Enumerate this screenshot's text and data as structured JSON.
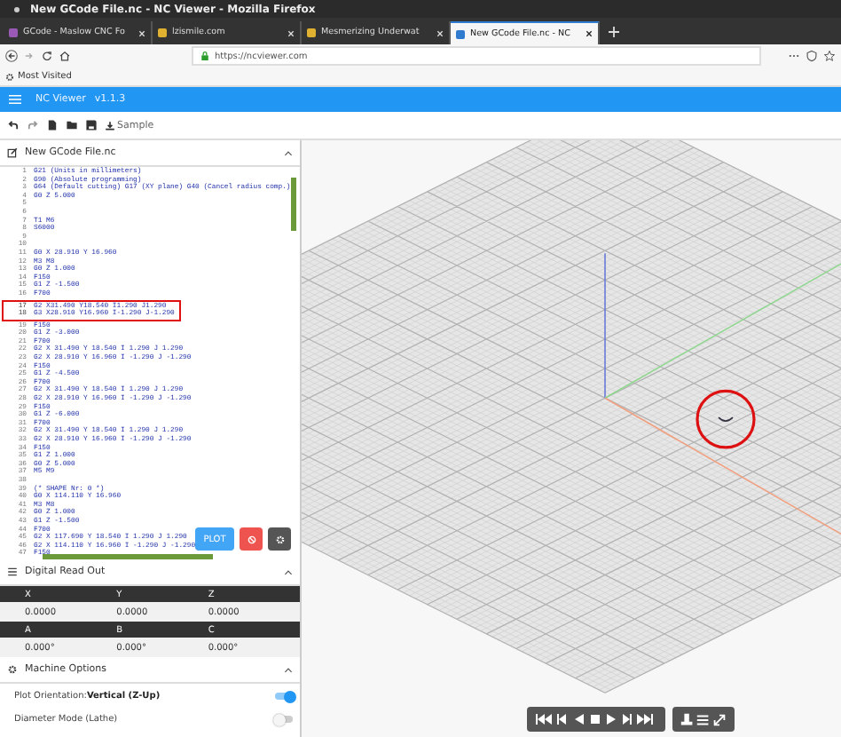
{
  "window": {
    "title": "New GCode File.nc - NC Viewer - Mozilla Firefox"
  },
  "browser_tabs": [
    {
      "label": "GCode - Maslow CNC Fo",
      "color": "#9b59b6",
      "selected": false
    },
    {
      "label": "lzismile.com",
      "color": "#e0b030",
      "selected": false
    },
    {
      "label": "Mesmerizing Underwat",
      "color": "#e0b030",
      "selected": false
    },
    {
      "label": "New GCode File.nc - NC",
      "color": "#2e7bcf",
      "selected": true
    }
  ],
  "address_bar": {
    "url": "https://ncviewer.com"
  },
  "bookmarks": [
    "Most Visited"
  ],
  "app": {
    "title": "NC Viewer",
    "version": "v1.1.3"
  },
  "toolbar": {
    "sample_label": "Sample"
  },
  "editor": {
    "file_name": "New GCode File.nc",
    "plot_label": "PLOT",
    "lines": [
      {
        "number": "1",
        "code": "G21 (Units in millimeters)",
        "marked": false
      },
      {
        "number": "2",
        "code": "G90 (Absolute programming)",
        "marked": false
      },
      {
        "number": "3",
        "code": "G64 (Default cutting) G17 (XY plane) G40 (Cancel radius comp.)",
        "marked": false
      },
      {
        "number": "4",
        "code": "G0 Z 5.000",
        "marked": false
      },
      {
        "number": "5",
        "marked": false
      },
      {
        "number": "6",
        "marked": false
      },
      {
        "number": "7",
        "code": "T1 M6",
        "marked": false
      },
      {
        "number": "8",
        "code": "S6000",
        "marked": false
      },
      {
        "number": "9",
        "marked": false
      },
      {
        "number": "10",
        "marked": false
      },
      {
        "number": "11",
        "code": "G0 X 28.910 Y 16.960",
        "marked": false
      },
      {
        "number": "12",
        "code": "M3 M8",
        "marked": false
      },
      {
        "number": "13",
        "code": "G0 Z 1.000",
        "marked": false
      },
      {
        "number": "14",
        "code": "F150",
        "marked": false
      },
      {
        "number": "15",
        "code": "G1 Z -1.500",
        "marked": false
      },
      {
        "number": "16",
        "code": "F700",
        "marked": false
      },
      {
        "number": "17",
        "code": "G2 X31.490 Y18.540 I1.290 J1.290",
        "marked": true
      },
      {
        "number": "18",
        "code": "G3 X28.910 Y16.960 I-1.290 J-1.290",
        "marked": true
      },
      {
        "number": "19",
        "code": "F150",
        "marked": false
      },
      {
        "number": "20",
        "code": "G1 Z -3.000",
        "marked": false
      },
      {
        "number": "21",
        "code": "F700",
        "marked": false
      },
      {
        "number": "22",
        "code": "G2 X 31.490 Y 18.540 I 1.290 J 1.290",
        "marked": false
      },
      {
        "number": "23",
        "code": "G2 X 28.910 Y 16.960 I -1.290 J -1.290",
        "marked": false
      },
      {
        "number": "24",
        "code": "F150",
        "marked": false
      },
      {
        "number": "25",
        "code": "G1 Z -4.500",
        "marked": false
      },
      {
        "number": "26",
        "code": "F700",
        "marked": false
      },
      {
        "number": "27",
        "code": "G2 X 31.490 Y 18.540 I 1.290 J 1.290",
        "marked": false
      },
      {
        "number": "28",
        "code": "G2 X 28.910 Y 16.960 I -1.290 J -1.290",
        "marked": false
      },
      {
        "number": "29",
        "code": "F150",
        "marked": false
      },
      {
        "number": "30",
        "code": "G1 Z -6.000",
        "marked": false
      },
      {
        "number": "31",
        "code": "F700",
        "marked": false
      },
      {
        "number": "32",
        "code": "G2 X 31.490 Y 18.540 I 1.290 J 1.290",
        "marked": false
      },
      {
        "number": "33",
        "code": "G2 X 28.910 Y 16.960 I -1.290 J -1.290",
        "marked": false
      },
      {
        "number": "34",
        "code": "F150",
        "marked": false
      },
      {
        "number": "35",
        "code": "G1 Z 1.000",
        "marked": false
      },
      {
        "number": "36",
        "code": "G0 Z 5.000",
        "marked": false
      },
      {
        "number": "37",
        "code": "M5 M9",
        "marked": false
      },
      {
        "number": "38",
        "marked": false
      },
      {
        "number": "39",
        "code": "(* SHAPE Nr: 0 *)",
        "marked": false
      },
      {
        "number": "40",
        "code": "G0 X 114.110 Y 16.960",
        "marked": false
      },
      {
        "number": "41",
        "code": "M3 M8",
        "marked": false
      },
      {
        "number": "42",
        "code": "G0 Z 1.000",
        "marked": false
      },
      {
        "number": "43",
        "code": "G1 Z -1.500",
        "marked": false
      },
      {
        "number": "44",
        "code": "F700",
        "marked": false
      },
      {
        "number": "45",
        "code": "G2 X 117.690 Y 18.540 I 1.290 J 1.290",
        "marked": false
      },
      {
        "number": "46",
        "code": "G2 X 114.110 Y 16.960 I -1.290 J -1.290",
        "marked": false
      },
      {
        "number": "47",
        "code": "F150",
        "marked": false
      }
    ]
  },
  "dro": {
    "title": "Digital Read Out",
    "rows": [
      [
        {
          "label": "X",
          "value": "0.0000"
        },
        {
          "label": "Y",
          "value": "0.0000"
        },
        {
          "label": "Z",
          "value": "0.0000"
        }
      ],
      [
        {
          "label": "A",
          "value": "0.000°"
        },
        {
          "label": "B",
          "value": "0.000°"
        },
        {
          "label": "C",
          "value": "0.000°"
        }
      ]
    ]
  },
  "machine_options": {
    "title": "Machine Options",
    "options": [
      {
        "label": "Plot Orientation:",
        "value": "Vertical (Z-Up)",
        "on": true
      },
      {
        "label": "Diameter Mode (Lathe)",
        "on": false
      }
    ]
  }
}
